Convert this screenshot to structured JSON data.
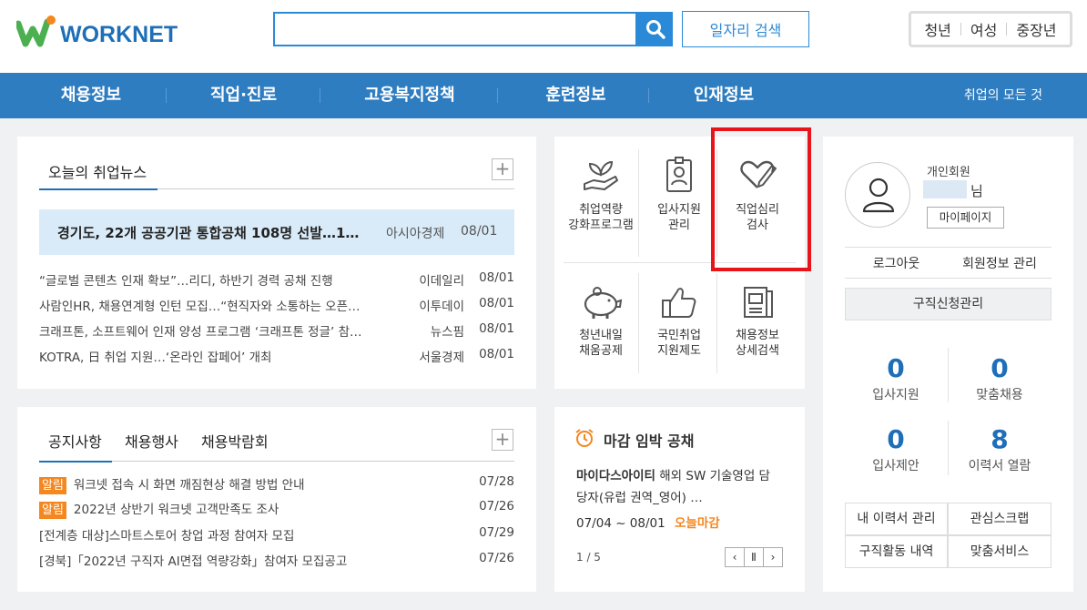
{
  "header": {
    "logo_text": "WORKNET",
    "search_placeholder": "",
    "job_search_label": "일자리 검색",
    "age_groups": [
      "청년",
      "여성",
      "중장년"
    ]
  },
  "nav": {
    "items": [
      "채용정보",
      "직업·진로",
      "고용복지정책",
      "훈련정보",
      "인재정보"
    ],
    "all_link": "취업의 모든 것"
  },
  "news": {
    "tab": "오늘의 취업뉴스",
    "plus": "+",
    "headline": {
      "title": "경기도, 22개 공공기관 통합공채 108명 선발…1…",
      "source": "아시아경제",
      "date": "08/01"
    },
    "items": [
      {
        "title": "“글로벌 콘텐츠 인재 확보”…리디, 하반기 경력 공채 진행",
        "source": "이데일리",
        "date": "08/01"
      },
      {
        "title": "사람인HR, 채용연계형 인턴 모집…“현직자와 소통하는 오픈…",
        "source": "이투데이",
        "date": "08/01"
      },
      {
        "title": "크래프톤, 소프트웨어 인재 양성 프로그램 ‘크래프톤 정글’ 참…",
        "source": "뉴스핌",
        "date": "08/01"
      },
      {
        "title": "KOTRA, 日 취업 지원…‘온라인 잡페어’ 개최",
        "source": "서울경제",
        "date": "08/01"
      }
    ]
  },
  "services": {
    "row1": [
      {
        "icon": "plant-hand-icon",
        "line1": "취업역량",
        "line2": "강화프로그램"
      },
      {
        "icon": "id-card-icon",
        "line1": "입사지원",
        "line2": "관리"
      },
      {
        "icon": "heart-pencil-icon",
        "line1": "직업심리",
        "line2": "검사"
      }
    ],
    "row2": [
      {
        "icon": "piggy-bank-icon",
        "line1": "청년내일",
        "line2": "채움공제"
      },
      {
        "icon": "thumbs-up-icon",
        "line1": "국민취업",
        "line2": "지원제도"
      },
      {
        "icon": "document-search-icon",
        "line1": "채용정보",
        "line2": "상세검색"
      }
    ]
  },
  "notice": {
    "tabs": [
      "공지사항",
      "채용행사",
      "채용박람회"
    ],
    "plus": "+",
    "badge": "알림",
    "items": [
      {
        "badge": true,
        "title": "워크넷 접속 시 화면 깨짐현상 해결 방법 안내",
        "date": "07/28"
      },
      {
        "badge": true,
        "title": "2022년 상반기 워크넷 고객만족도 조사",
        "date": "07/26"
      },
      {
        "badge": false,
        "title": "[전계층 대상]스마트스토어 창업 과정 참여자 모집",
        "date": "07/29"
      },
      {
        "badge": false,
        "title": "[경북]「2022년 구직자 AI면접 역량강화」참여자 모집공고",
        "date": "07/26"
      }
    ]
  },
  "deadline": {
    "title": "마감 임박 공채",
    "company": "마이다스아이티",
    "desc1": "해외 SW 기술영업 담",
    "desc2": "당자(유럽 권역_영어) …",
    "period": "07/04 ~ 08/01",
    "today": "오늘마감",
    "page": "1 / 5",
    "pager": [
      "‹",
      "Ⅱ",
      "›"
    ]
  },
  "member": {
    "type": "개인회원",
    "suffix": "님",
    "mypage": "마이페이지",
    "logout": "로그아웃",
    "edit": "회원정보 관리",
    "apply_mgmt": "구직신청관리",
    "stats": [
      {
        "value": "0",
        "label": "입사지원"
      },
      {
        "value": "0",
        "label": "맞춤채용"
      },
      {
        "value": "0",
        "label": "입사제안"
      },
      {
        "value": "8",
        "label": "이력서 열람"
      }
    ],
    "links": [
      "내 이력서 관리",
      "관심스크랩",
      "구직활동 내역",
      "맞춤서비스"
    ]
  },
  "colors": {
    "nav": "#2f7dc1",
    "accent": "#2a8ad7",
    "badge": "#f4871f",
    "stat": "#1e6fb8",
    "highlight": "#e8141a"
  }
}
